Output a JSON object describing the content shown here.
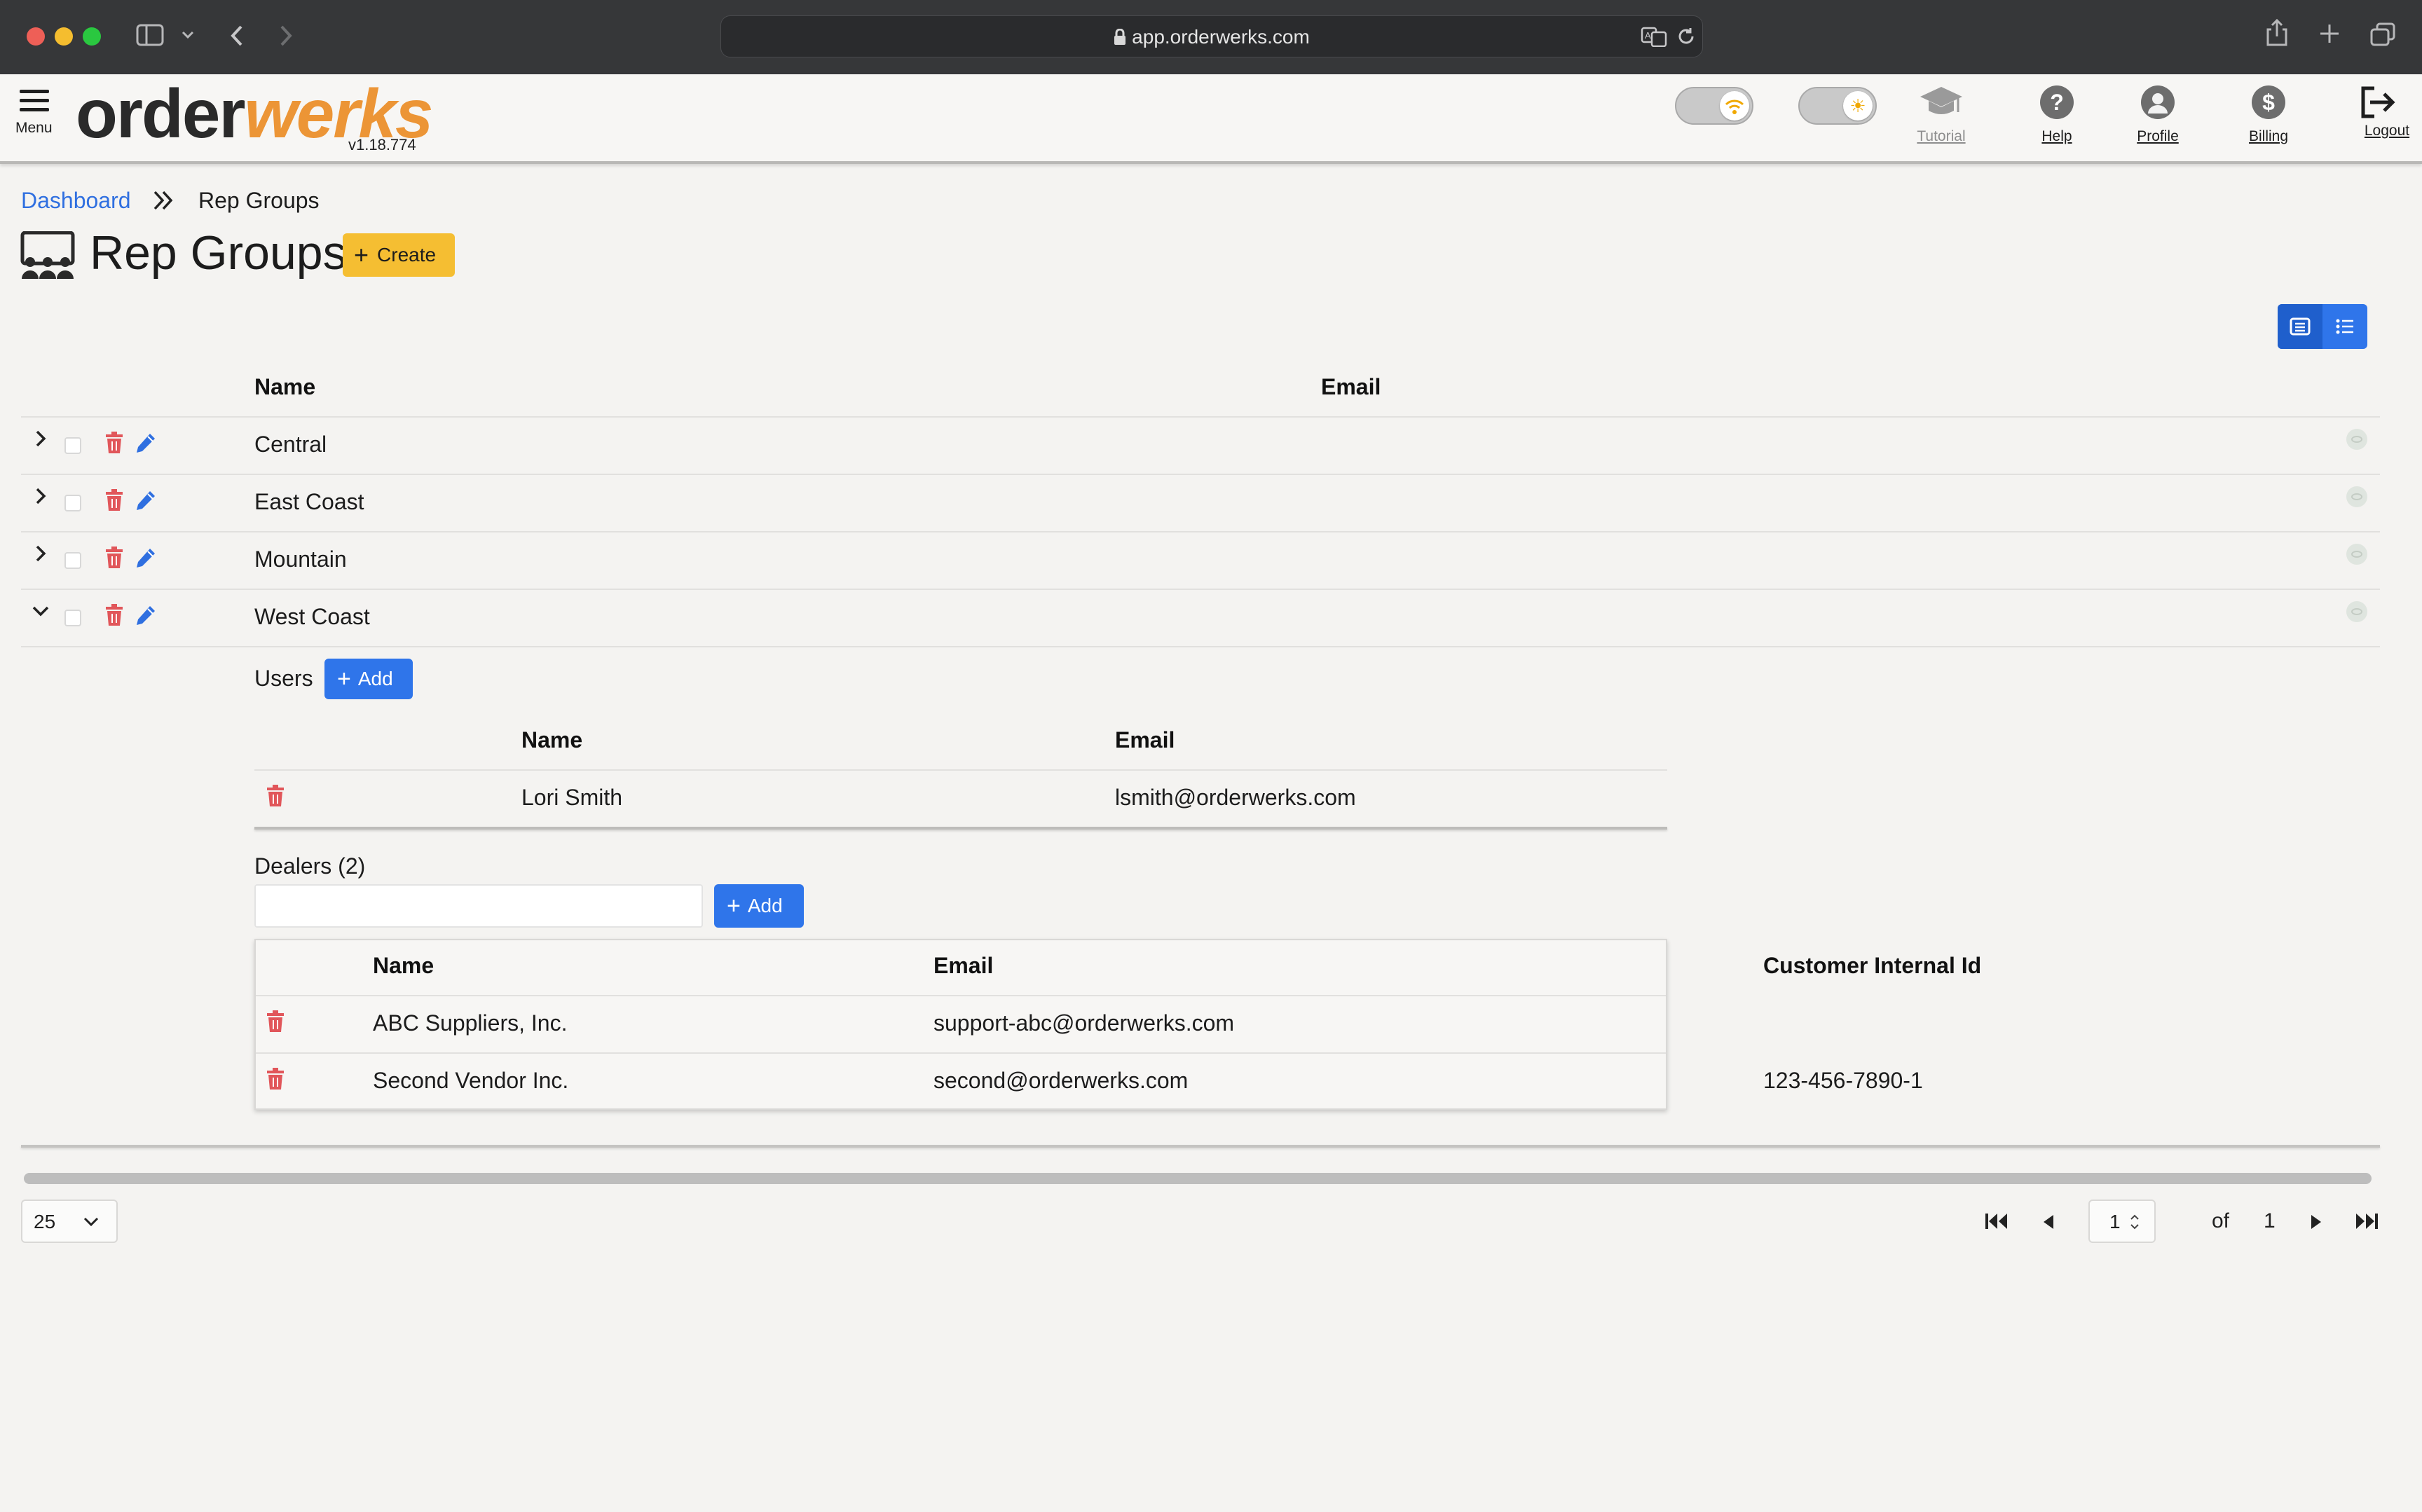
{
  "browser": {
    "url": "app.orderwerks.com"
  },
  "header": {
    "menu_label": "Menu",
    "logo_part1": "order",
    "logo_part2": "werks",
    "version": "v1.18.774",
    "nav": [
      {
        "label": "Tutorial",
        "icon": "graduation-cap-icon"
      },
      {
        "label": "Help",
        "icon": "question-icon"
      },
      {
        "label": "Profile",
        "icon": "user-icon"
      },
      {
        "label": "Billing",
        "icon": "dollar-icon"
      },
      {
        "label": "Logout",
        "icon": "logout-icon"
      }
    ],
    "toggles": [
      {
        "icon": "wifi-icon",
        "state": "on"
      },
      {
        "icon": "sun-icon",
        "state": "on"
      }
    ],
    "icons": {
      "help": "?",
      "billing": "$"
    }
  },
  "breadcrumb": {
    "items": [
      "Dashboard",
      "Rep Groups"
    ],
    "separator": "»"
  },
  "page": {
    "title": "Rep Groups",
    "create_label": "Create",
    "colors": {
      "accent": "#2f75ea",
      "create": "#f5be32",
      "logo_dark": "#2a2a2a",
      "logo_orange": "#ec9536",
      "delete": "#e1565a"
    }
  },
  "table": {
    "columns": [
      "Name",
      "Email"
    ],
    "rows": [
      {
        "name": "Central",
        "expanded": false
      },
      {
        "name": "East Coast",
        "expanded": false
      },
      {
        "name": "Mountain",
        "expanded": false
      },
      {
        "name": "West Coast",
        "expanded": true
      }
    ]
  },
  "expanded": {
    "users": {
      "label": "Users",
      "add_label": "Add",
      "columns": [
        "Name",
        "Email"
      ],
      "rows": [
        {
          "name": "Lori Smith",
          "email": "lsmith@orderwerks.com"
        }
      ]
    },
    "dealers": {
      "label": "Dealers (2)",
      "search_value": "",
      "add_label": "Add",
      "columns": [
        "Name",
        "Email",
        "Customer Internal Id"
      ],
      "rows": [
        {
          "name": "ABC Suppliers, Inc.",
          "email": "support-abc@orderwerks.com",
          "internal_id": ""
        },
        {
          "name": "Second Vendor Inc.",
          "email": "second@orderwerks.com",
          "internal_id": "123-456-7890-1"
        }
      ]
    }
  },
  "pagination": {
    "page_size": "25",
    "current_page": "1",
    "of_label": "of",
    "total_pages": "1"
  }
}
